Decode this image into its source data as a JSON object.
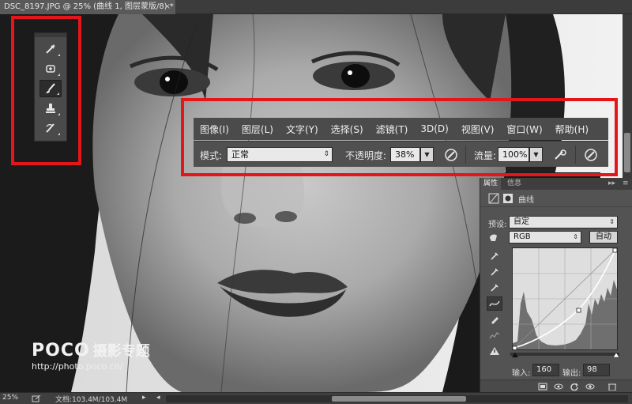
{
  "document_tab": {
    "title": "DSC_8197.JPG @ 25% (曲线 1, 图层蒙版/8) *",
    "close": "×"
  },
  "menu": {
    "items": [
      "图像(I)",
      "图层(L)",
      "文字(Y)",
      "选择(S)",
      "滤镜(T)",
      "3D(D)",
      "视图(V)",
      "窗口(W)",
      "帮助(H)"
    ]
  },
  "options": {
    "mode_label": "模式:",
    "mode_value": "正常",
    "opacity_label": "不透明度:",
    "opacity_value": "38%",
    "flow_label": "流量:",
    "flow_value": "100%"
  },
  "tools": {
    "items": [
      {
        "icon": "eyedropper-icon",
        "active": false
      },
      {
        "icon": "spot-healing-icon",
        "active": false
      },
      {
        "icon": "brush-icon",
        "active": true
      },
      {
        "icon": "clone-stamp-icon",
        "active": false
      },
      {
        "icon": "history-brush-icon",
        "active": false
      }
    ]
  },
  "properties": {
    "tabs": [
      "属性",
      "信息"
    ],
    "collapse": "▸▸",
    "title": "曲线",
    "preset_label": "预设:",
    "preset_value": "自定",
    "channel_value": "RGB",
    "auto_label": "自动",
    "input_label": "输入:",
    "input_value": "160",
    "output_label": "输出:",
    "output_value": "98"
  },
  "status": {
    "zoom": "25%",
    "doc": "文档:103.4M/103.4M",
    "arrow": "▸",
    "scroll_left": "◂"
  },
  "watermark": {
    "logo": "POCO",
    "subtitle": "摄影专题",
    "url": "http://photo.poco.cn/"
  },
  "colors": {
    "annotation": "#e4161b",
    "panel": "#535353",
    "menu_bg": "#4b4b4b"
  }
}
